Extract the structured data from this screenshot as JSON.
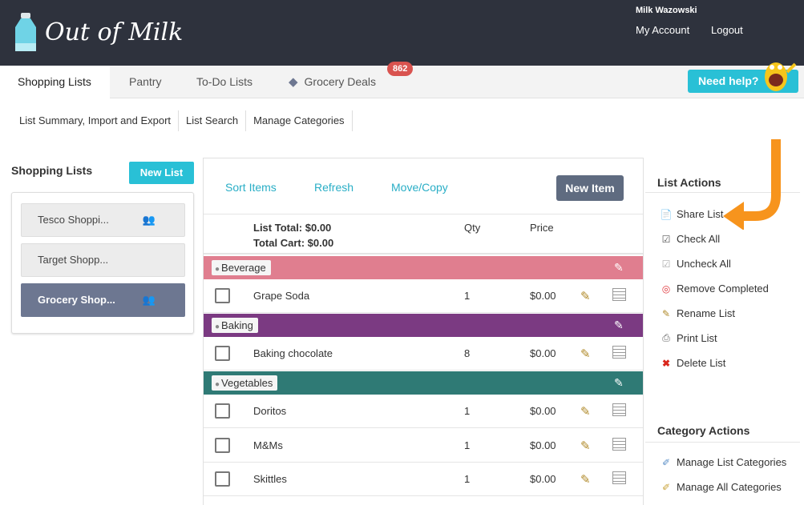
{
  "app": {
    "logo_text": "Out of Milk"
  },
  "account": {
    "username": "Milk Wazowski",
    "my_account": "My Account",
    "logout": "Logout"
  },
  "tabs": [
    {
      "label": "Shopping Lists"
    },
    {
      "label": "Pantry"
    },
    {
      "label": "To-Do Lists"
    },
    {
      "label": "Grocery Deals"
    }
  ],
  "deals_badge": "862",
  "help_button": "Need help?",
  "subnav": [
    "List Summary, Import and Export",
    "List Search",
    "Manage Categories"
  ],
  "lists": {
    "heading": "Shopping Lists",
    "new_button": "New List",
    "items": [
      {
        "name": "Tesco Shoppi..."
      },
      {
        "name": "Target Shopp..."
      },
      {
        "name": "Grocery Shop..."
      }
    ]
  },
  "toolbar": {
    "sort": "Sort Items",
    "refresh": "Refresh",
    "move": "Move/Copy",
    "new_item": "New Item"
  },
  "totals": {
    "list_total": "List Total: $0.00",
    "cart_total": "Total Cart: $0.00",
    "qty_header": "Qty",
    "price_header": "Price"
  },
  "categories": [
    {
      "name": "Beverage",
      "color": "#e07e8f",
      "items": [
        {
          "name": "Grape Soda",
          "qty": "1",
          "price": "$0.00"
        }
      ]
    },
    {
      "name": "Baking",
      "color": "#7b3a82",
      "items": [
        {
          "name": "Baking chocolate",
          "qty": "8",
          "price": "$0.00"
        }
      ]
    },
    {
      "name": "Vegetables",
      "color": "#2f7a75",
      "items": [
        {
          "name": "Doritos",
          "qty": "1",
          "price": "$0.00"
        },
        {
          "name": "M&Ms",
          "qty": "1",
          "price": "$0.00"
        },
        {
          "name": "Skittles",
          "qty": "1",
          "price": "$0.00"
        }
      ]
    }
  ],
  "list_actions": {
    "heading": "List Actions",
    "items": [
      {
        "label": "Share List",
        "icon": "share-icon"
      },
      {
        "label": "Check All",
        "icon": "check-icon"
      },
      {
        "label": "Uncheck All",
        "icon": "uncheck-icon"
      },
      {
        "label": "Remove Completed",
        "icon": "target-icon"
      },
      {
        "label": "Rename List",
        "icon": "rename-icon"
      },
      {
        "label": "Print List",
        "icon": "printer-icon"
      },
      {
        "label": "Delete List",
        "icon": "delete-icon"
      }
    ]
  },
  "category_actions": {
    "heading": "Category Actions",
    "items": [
      {
        "label": "Manage List Categories",
        "icon": "tags-icon"
      },
      {
        "label": "Manage All Categories",
        "icon": "tag-icon"
      }
    ]
  },
  "colors": {
    "topbar": "#2e323d",
    "accent": "#29c0d6",
    "selected_list": "#6d7791",
    "arrow": "#f7941d"
  }
}
